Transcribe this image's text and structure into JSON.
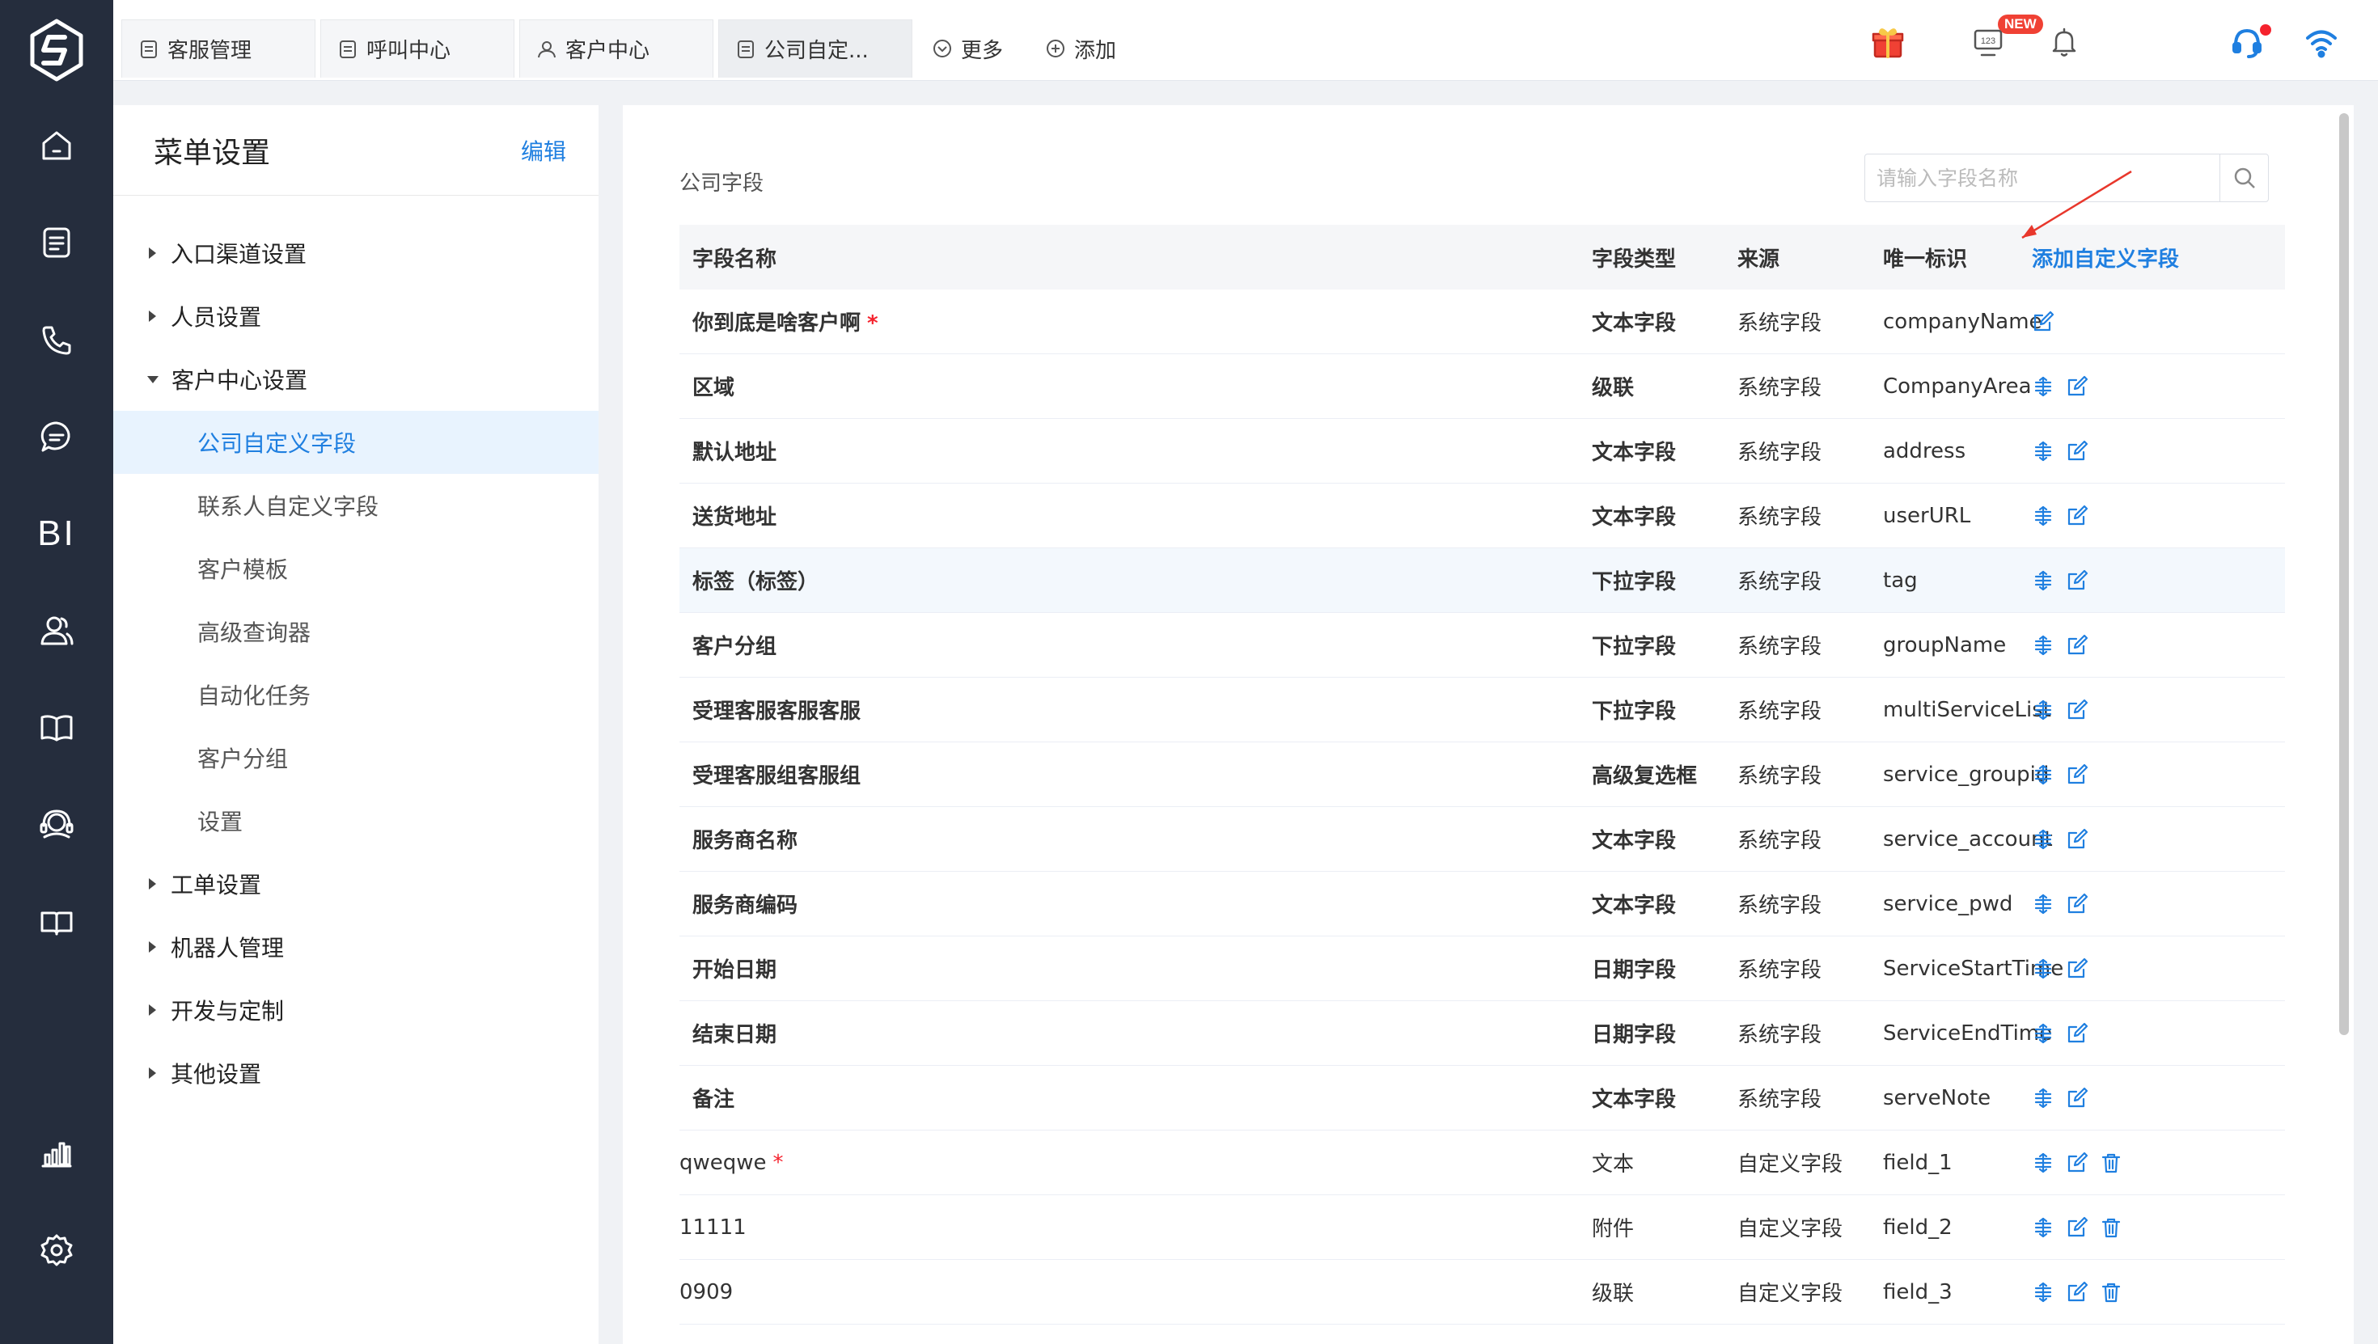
{
  "rail": {
    "items": [
      "home-icon",
      "document-icon",
      "phone-icon",
      "chat-icon",
      "bi",
      "users-icon",
      "book-icon",
      "headset-icon",
      "book-open-icon",
      "chart-bars-icon",
      "gear-icon"
    ],
    "bi_label": "BI"
  },
  "topbar": {
    "tabs": [
      {
        "label": "客服管理",
        "icon": "document-icon"
      },
      {
        "label": "呼叫中心",
        "icon": "document-icon"
      },
      {
        "label": "客户中心",
        "icon": "user-icon"
      },
      {
        "label": "公司自定...",
        "icon": "document-icon",
        "active": true
      }
    ],
    "more_label": "更多",
    "add_label": "添加",
    "new_badge": "NEW",
    "keypad_label": "123"
  },
  "menu": {
    "title": "菜单设置",
    "edit_label": "编辑",
    "groups": [
      {
        "label": "入口渠道设置",
        "expanded": false
      },
      {
        "label": "人员设置",
        "expanded": false
      },
      {
        "label": "客户中心设置",
        "expanded": true
      }
    ],
    "sub_items": [
      "公司自定义字段",
      "联系人自定义字段",
      "客户模板",
      "高级查询器",
      "自动化任务",
      "客户分组",
      "设置"
    ],
    "selected_sub": "公司自定义字段",
    "groups_after": [
      "工单设置",
      "机器人管理",
      "开发与定制",
      "其他设置"
    ]
  },
  "content": {
    "section_title": "公司字段",
    "search": {
      "placeholder": "请输入字段名称",
      "value": ""
    },
    "table": {
      "headers": {
        "name": "字段名称",
        "type": "字段类型",
        "source": "来源",
        "id": "唯一标识",
        "add": "添加自定义字段"
      },
      "rows": [
        {
          "name": "你到底是啥客户啊",
          "required": true,
          "type": "文本字段",
          "source": "系统字段",
          "id": "companyName",
          "ops": [
            "edit"
          ],
          "system": true
        },
        {
          "name": "区域",
          "required": false,
          "type": "级联",
          "source": "系统字段",
          "id": "CompanyArea",
          "ops": [
            "sort",
            "edit"
          ],
          "system": true
        },
        {
          "name": "默认地址",
          "required": false,
          "type": "文本字段",
          "source": "系统字段",
          "id": "address",
          "ops": [
            "sort",
            "edit"
          ],
          "system": true
        },
        {
          "name": "送货地址",
          "required": false,
          "type": "文本字段",
          "source": "系统字段",
          "id": "userURL",
          "ops": [
            "sort",
            "edit"
          ],
          "system": true
        },
        {
          "name": "标签（标签）",
          "required": false,
          "type": "下拉字段",
          "source": "系统字段",
          "id": "tag",
          "ops": [
            "sort",
            "edit"
          ],
          "system": true,
          "hover": true
        },
        {
          "name": "客户分组",
          "required": false,
          "type": "下拉字段",
          "source": "系统字段",
          "id": "groupName",
          "ops": [
            "sort",
            "edit"
          ],
          "system": true
        },
        {
          "name": "受理客服客服客服",
          "required": false,
          "type": "下拉字段",
          "source": "系统字段",
          "id": "multiServiceList",
          "ops": [
            "sort",
            "edit"
          ],
          "system": true
        },
        {
          "name": "受理客服组客服组",
          "required": false,
          "type": "高级复选框",
          "source": "系统字段",
          "id": "service_groupid",
          "ops": [
            "sort",
            "edit"
          ],
          "system": true
        },
        {
          "name": "服务商名称",
          "required": false,
          "type": "文本字段",
          "source": "系统字段",
          "id": "service_account",
          "ops": [
            "sort",
            "edit"
          ],
          "system": true
        },
        {
          "name": "服务商编码",
          "required": false,
          "type": "文本字段",
          "source": "系统字段",
          "id": "service_pwd",
          "ops": [
            "sort",
            "edit"
          ],
          "system": true
        },
        {
          "name": "开始日期",
          "required": false,
          "type": "日期字段",
          "source": "系统字段",
          "id": "ServiceStartTime",
          "ops": [
            "sort",
            "edit"
          ],
          "system": true
        },
        {
          "name": "结束日期",
          "required": false,
          "type": "日期字段",
          "source": "系统字段",
          "id": "ServiceEndTime",
          "ops": [
            "sort",
            "edit"
          ],
          "system": true
        },
        {
          "name": "备注",
          "required": false,
          "type": "文本字段",
          "source": "系统字段",
          "id": "serveNote",
          "ops": [
            "sort",
            "edit"
          ],
          "system": true
        },
        {
          "name": "qweqwe",
          "required": true,
          "type": "文本",
          "source": "自定义字段",
          "id": "field_1",
          "ops": [
            "sort",
            "edit",
            "delete"
          ],
          "system": false
        },
        {
          "name": "11111",
          "required": false,
          "type": "附件",
          "source": "自定义字段",
          "id": "field_2",
          "ops": [
            "sort",
            "edit",
            "delete"
          ],
          "system": false
        },
        {
          "name": "0909",
          "required": false,
          "type": "级联",
          "source": "自定义字段",
          "id": "field_3",
          "ops": [
            "sort",
            "edit",
            "delete"
          ],
          "system": false
        }
      ]
    }
  },
  "colors": {
    "accent": "#1f7fe0",
    "rail_bg": "#252d3d",
    "required": "#f5222d",
    "annotation_arrow": "#e8372c"
  }
}
